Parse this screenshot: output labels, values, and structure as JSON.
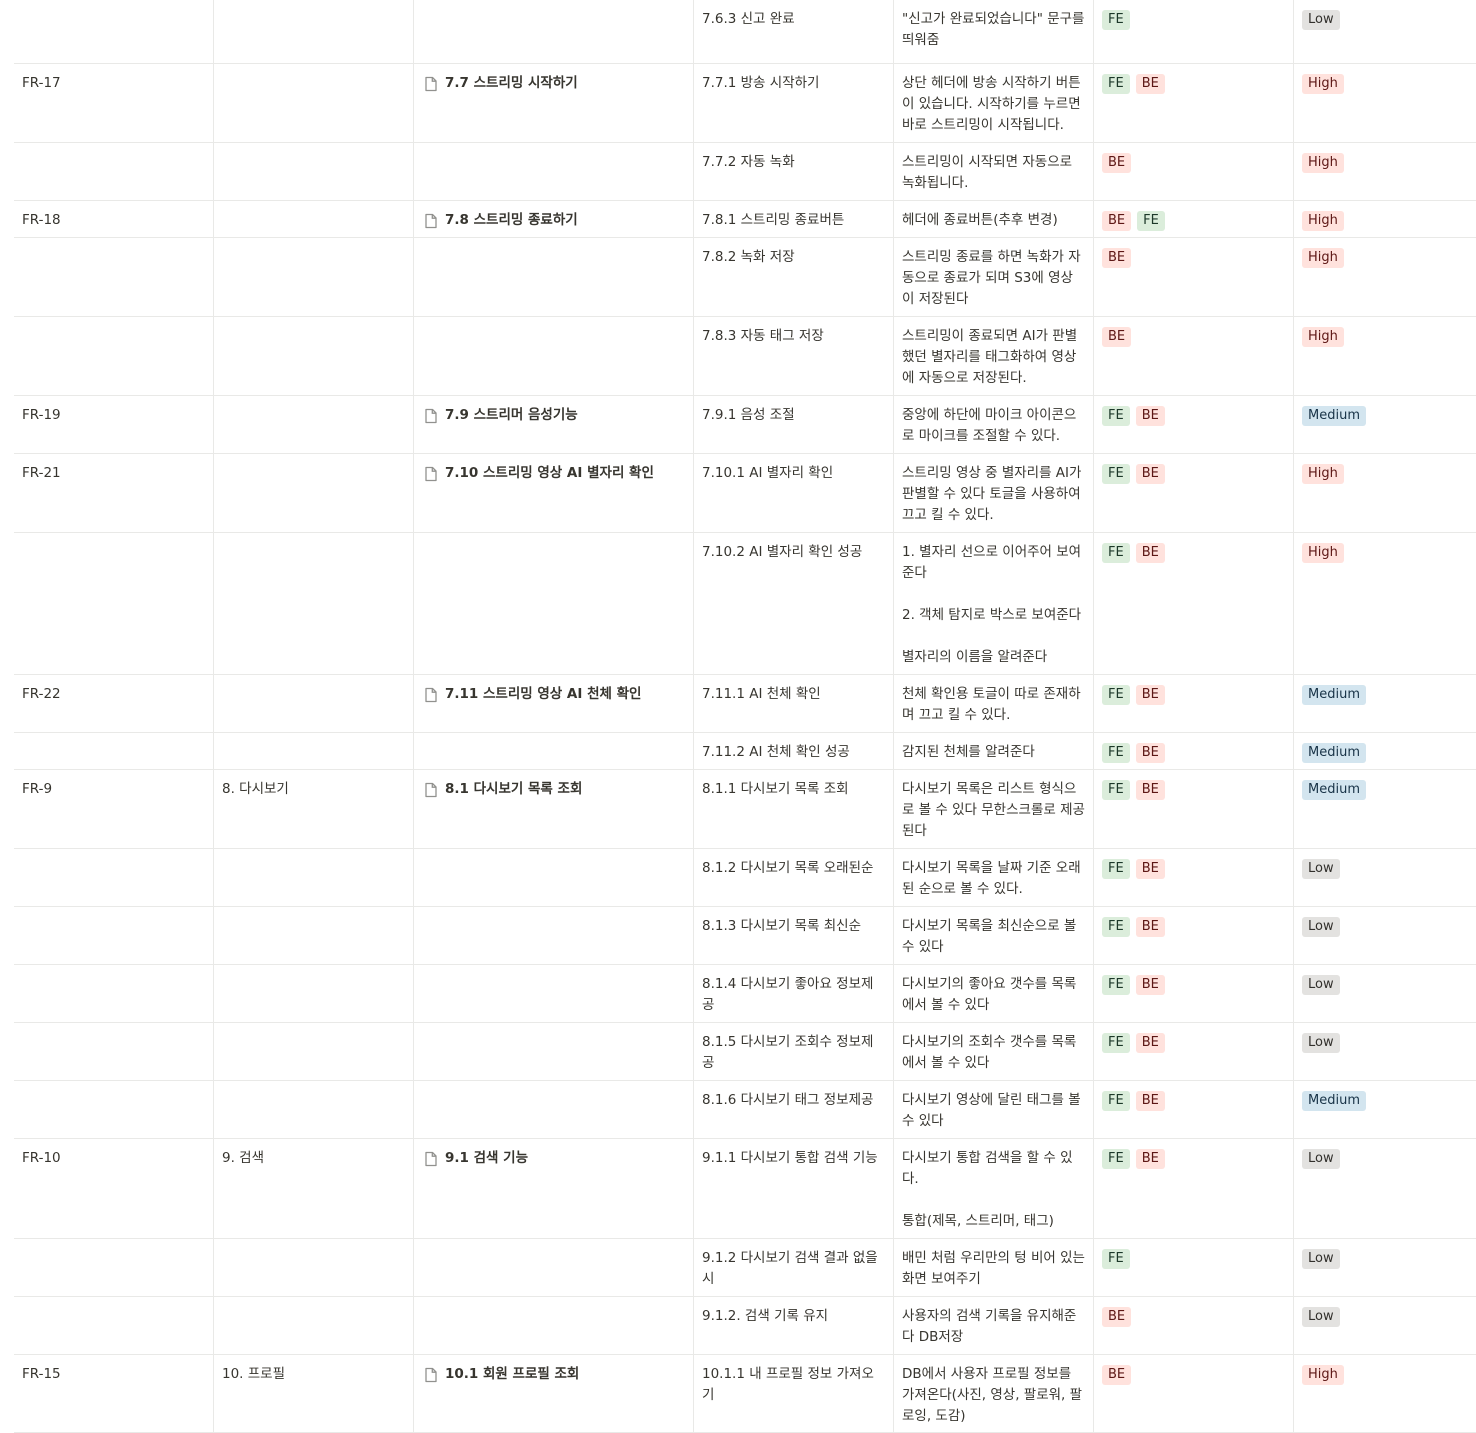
{
  "colors": {
    "tag_fe_bg": "#dbeddb",
    "tag_be_bg": "#ffe2dd",
    "priority_high_bg": "#ffe2dd",
    "priority_low_bg": "#e3e2e0",
    "priority_medium_bg": "#d3e5ef",
    "grid_line": "#e9e9e7"
  },
  "rows": [
    {
      "id": "",
      "category": "",
      "page": "",
      "detail": "7.6.3 신고 완료",
      "desc": [
        "\"신고가 완료되었습니다\" 문구를 띄워줌"
      ],
      "tags": [
        "FE"
      ],
      "priority": "Low"
    },
    {
      "id": "FR-17",
      "category": "",
      "page": "7.7 스트리밍 시작하기",
      "detail": "7.7.1 방송 시작하기",
      "desc": [
        "상단 헤더에 방송 시작하기 버튼이 있습니다. 시작하기를 누르면 바로 스트리밍이 시작됩니다."
      ],
      "tags": [
        "FE",
        "BE"
      ],
      "priority": "High"
    },
    {
      "id": "",
      "category": "",
      "page": "",
      "detail": "7.7.2 자동 녹화",
      "desc": [
        "스트리밍이 시작되면 자동으로 녹화됩니다."
      ],
      "tags": [
        "BE"
      ],
      "priority": "High"
    },
    {
      "id": "FR-18",
      "category": "",
      "page": "7.8 스트리밍 종료하기",
      "detail": "7.8.1  스트리밍 종료버튼",
      "desc": [
        "헤더에 종료버튼(추후 변경)"
      ],
      "tags": [
        "BE",
        "FE"
      ],
      "priority": "High"
    },
    {
      "id": "",
      "category": "",
      "page": "",
      "detail": "7.8.2 녹화 저장",
      "desc": [
        "스트리밍 종료를 하면 녹화가 자동으로 종료가 되며 S3에 영상이 저장된다"
      ],
      "tags": [
        "BE"
      ],
      "priority": "High"
    },
    {
      "id": "",
      "category": "",
      "page": "",
      "detail": "7.8.3 자동 태그 저장",
      "desc": [
        "스트리밍이 종료되면 AI가 판별했던 별자리를 태그화하여 영상에 자동으로 저장된다."
      ],
      "tags": [
        "BE"
      ],
      "priority": "High"
    },
    {
      "id": "FR-19",
      "category": "",
      "page": "7.9 스트리머 음성기능",
      "detail": "7.9.1  음성 조절",
      "desc": [
        "중앙에 하단에 마이크 아이콘으로 마이크를 조절할 수 있다."
      ],
      "tags": [
        "FE",
        "BE"
      ],
      "priority": "Medium"
    },
    {
      "id": "FR-21",
      "category": "",
      "page": "7.10 스트리밍 영상 AI 별자리 확인",
      "detail": "7.10.1 AI 별자리 확인",
      "desc": [
        "스트리밍 영상 중 별자리를 AI가 판별할 수 있다 토글을 사용하여 끄고 킬 수 있다."
      ],
      "tags": [
        "FE",
        "BE"
      ],
      "priority": "High"
    },
    {
      "id": "",
      "category": "",
      "page": "",
      "detail": "7.10.2 AI 별자리 확인 성공",
      "desc": [
        "1. 별자리 선으로 이어주어 보여준다",
        "",
        "2. 객체 탐지로 박스로 보여준다",
        "",
        "별자리의 이름을 알려준다"
      ],
      "tags": [
        "FE",
        "BE"
      ],
      "priority": "High"
    },
    {
      "id": "FR-22",
      "category": "",
      "page": "7.11 스트리밍 영상 AI 천체 확인",
      "detail": "7.11.1 AI 천체 확인",
      "desc": [
        "천체 확인용 토글이 따로 존재하며 끄고 킬 수 있다."
      ],
      "tags": [
        "FE",
        "BE"
      ],
      "priority": "Medium"
    },
    {
      "id": "",
      "category": "",
      "page": "",
      "detail": "7.11.2 AI 천체 확인 성공",
      "desc": [
        "감지된 천체를 알려준다"
      ],
      "tags": [
        "FE",
        "BE"
      ],
      "priority": "Medium"
    },
    {
      "id": "FR-9",
      "category": "8. 다시보기",
      "page": "8.1 다시보기 목록 조회",
      "detail": "8.1.1 다시보기 목록 조회",
      "desc": [
        "다시보기 목록은 리스트 형식으로 볼 수 있다 무한스크롤로 제공된다"
      ],
      "tags": [
        "FE",
        "BE"
      ],
      "priority": "Medium"
    },
    {
      "id": "",
      "category": "",
      "page": "",
      "detail": "8.1.2 다시보기 목록 오래된순",
      "desc": [
        "다시보기 목록을 날짜 기준 오래된 순으로 볼 수 있다."
      ],
      "tags": [
        "FE",
        "BE"
      ],
      "priority": "Low"
    },
    {
      "id": "",
      "category": "",
      "page": "",
      "detail": "8.1.3 다시보기 목록 최신순",
      "desc": [
        "다시보기 목록을 최신순으로 볼 수 있다"
      ],
      "tags": [
        "FE",
        "BE"
      ],
      "priority": "Low"
    },
    {
      "id": "",
      "category": "",
      "page": "",
      "detail": "8.1.4 다시보기 좋아요 정보제공",
      "desc": [
        "다시보기의 좋아요 갯수를 목록에서 볼 수 있다"
      ],
      "tags": [
        "FE",
        "BE"
      ],
      "priority": "Low"
    },
    {
      "id": "",
      "category": "",
      "page": "",
      "detail": "8.1.5 다시보기 조회수 정보제공",
      "desc": [
        "다시보기의 조회수 갯수를 목록에서 볼 수 있다"
      ],
      "tags": [
        "FE",
        "BE"
      ],
      "priority": "Low"
    },
    {
      "id": "",
      "category": "",
      "page": "",
      "detail": "8.1.6 다시보기 태그 정보제공",
      "desc": [
        "다시보기 영상에 달린 태그를 볼 수 있다"
      ],
      "tags": [
        "FE",
        "BE"
      ],
      "priority": "Medium"
    },
    {
      "id": "FR-10",
      "category": "9. 검색",
      "page": "9.1 검색 기능",
      "detail": "9.1.1 다시보기 통합 검색 기능",
      "desc": [
        "다시보기 통합 검색을 할 수 있다.",
        "",
        "통합(제목, 스트리머, 태그)"
      ],
      "tags": [
        "FE",
        "BE"
      ],
      "priority": "Low"
    },
    {
      "id": "",
      "category": "",
      "page": "",
      "detail": "9.1.2 다시보기 검색 결과 없을 시",
      "desc": [
        "배민 처럼 우리만의 텅 비어 있는 화면 보여주기"
      ],
      "tags": [
        "FE"
      ],
      "priority": "Low"
    },
    {
      "id": "",
      "category": "",
      "page": "",
      "detail": "9.1.2. 검색 기록 유지",
      "desc": [
        "사용자의 검색 기록을 유지해준다 DB저장"
      ],
      "tags": [
        "BE"
      ],
      "priority": "Low"
    },
    {
      "id": "FR-15",
      "category": "10. 프로필",
      "page": "10.1 회원 프로필 조회",
      "detail": "10.1.1 내 프로필 정보 가져오기",
      "desc": [
        "DB에서 사용자 프로필 정보를 가져온다(사진, 영상, 팔로워, 팔로잉, 도감)"
      ],
      "tags": [
        "BE"
      ],
      "priority": "High"
    }
  ]
}
